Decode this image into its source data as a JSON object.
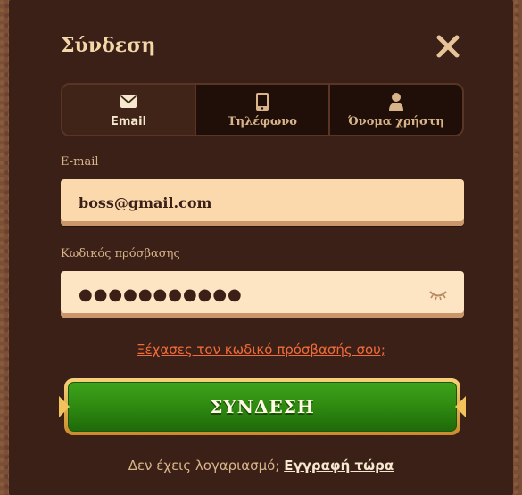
{
  "dialog": {
    "title": "Σύνδεση",
    "close_icon": "close-icon"
  },
  "tabs": [
    {
      "label": "Email",
      "icon": "envelope-icon",
      "active": true
    },
    {
      "label": "Τηλέφωνο",
      "icon": "phone-icon",
      "active": false
    },
    {
      "label": "Όνομα χρήστη",
      "icon": "user-icon",
      "active": false
    }
  ],
  "email": {
    "label": "E-mail",
    "value": "boss@gmail.com"
  },
  "password": {
    "label": "Κωδικός πρόσβασης",
    "value": "●●●●●●●●●●●",
    "toggle_icon": "eye-closed-icon"
  },
  "forgot_link": "Ξέχασες τον κωδικό πρόσβασής σου;",
  "login_button": "ΣΥΝΔΕΣΗ",
  "signup": {
    "prompt": "Δεν έχεις λογαριασμό;",
    "link": "Εγγραφή τώρα"
  },
  "colors": {
    "dialog_bg": "#3a2016",
    "accent_text": "#f4d7a8",
    "link_orange": "#f26b3b",
    "button_green": "#2e8a10",
    "input_bg": "#fbd9ad"
  }
}
